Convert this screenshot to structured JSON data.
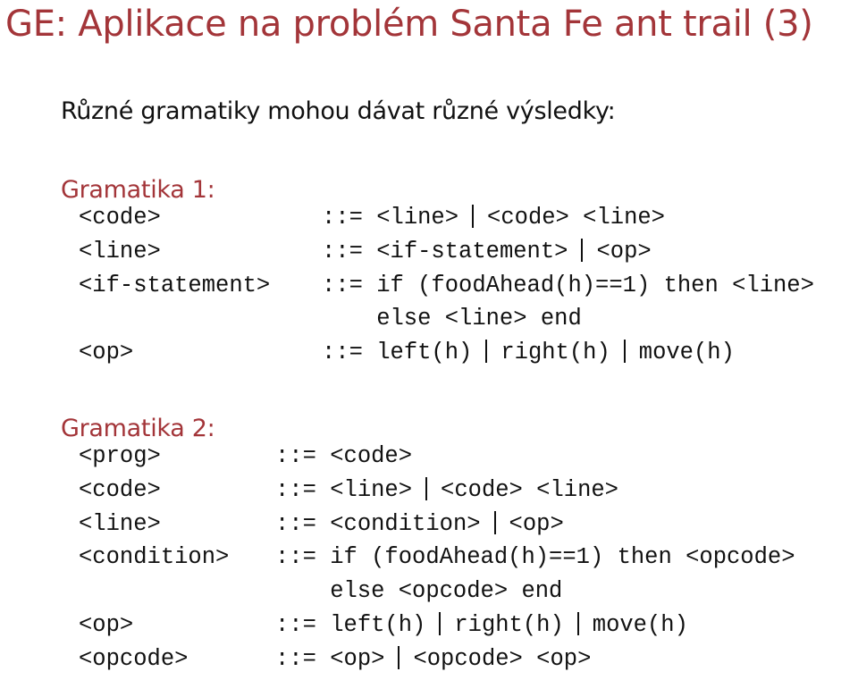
{
  "title": "GE: Aplikace na problém Santa Fe ant trail (3)",
  "intro": "Různé gramatiky mohou dávat různé výsledky:",
  "accent_color": "#a33539",
  "grammars": [
    {
      "heading": "Gramatika 1:",
      "rules": [
        {
          "lhs": "<code>",
          "op": "::=",
          "alternatives": [
            "<line>",
            "<code> <line>"
          ]
        },
        {
          "lhs": "<line>",
          "op": "::=",
          "alternatives": [
            "<if-statement>",
            "<op>"
          ]
        },
        {
          "lhs": "<if-statement>",
          "op": "::=",
          "alternatives": [
            "if (foodAhead(h)==1) then <line>"
          ],
          "continuation": "else <line> end"
        },
        {
          "lhs": "<op>",
          "op": "::=",
          "alternatives": [
            "left(h)",
            "right(h)",
            "move(h)"
          ]
        }
      ]
    },
    {
      "heading": "Gramatika 2:",
      "rules": [
        {
          "lhs": "<prog>",
          "op": "::=",
          "alternatives": [
            "<code>"
          ]
        },
        {
          "lhs": "<code>",
          "op": "::=",
          "alternatives": [
            "<line>",
            "<code> <line>"
          ]
        },
        {
          "lhs": "<line>",
          "op": "::=",
          "alternatives": [
            "<condition>",
            "<op>"
          ]
        },
        {
          "lhs": "<condition>",
          "op": "::=",
          "alternatives": [
            "if (foodAhead(h)==1) then <opcode>"
          ],
          "continuation": "else <opcode> end"
        },
        {
          "lhs": "<op>",
          "op": "::=",
          "alternatives": [
            "left(h)",
            "right(h)",
            "move(h)"
          ]
        },
        {
          "lhs": "<opcode>",
          "op": "::=",
          "alternatives": [
            "<op>",
            "<opcode> <op>"
          ]
        }
      ]
    }
  ]
}
